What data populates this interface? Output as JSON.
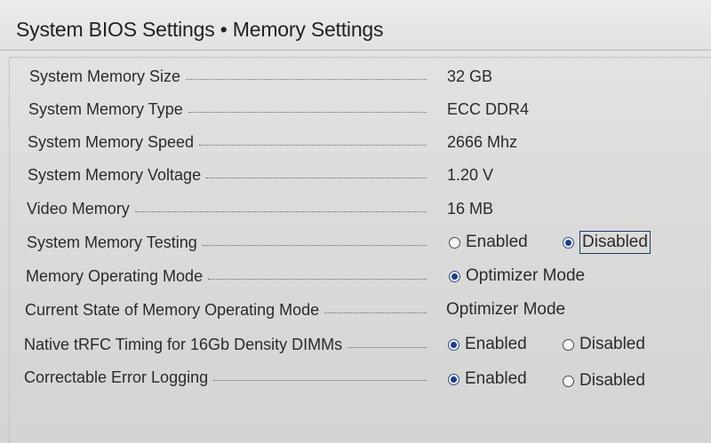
{
  "header": {
    "title": "System BIOS Settings • Memory Settings"
  },
  "rows": [
    {
      "label": "System Memory Size",
      "value": "32 GB"
    },
    {
      "label": "System Memory Type",
      "value": "ECC DDR4"
    },
    {
      "label": "System Memory Speed",
      "value": "2666 Mhz"
    },
    {
      "label": "System Memory Voltage",
      "value": "1.20 V"
    },
    {
      "label": "Video Memory",
      "value": "16 MB"
    },
    {
      "label": "System Memory Testing",
      "options": [
        "Enabled",
        "Disabled"
      ],
      "selected": "Disabled"
    },
    {
      "label": "Memory Operating Mode",
      "options": [
        "Optimizer Mode"
      ],
      "selected": "Optimizer Mode"
    },
    {
      "label": "Current State of Memory Operating Mode",
      "value": "Optimizer Mode"
    },
    {
      "label": "Native tRFC Timing for 16Gb Density DIMMs",
      "options": [
        "Enabled",
        "Disabled"
      ],
      "selected": "Enabled"
    },
    {
      "label": "Correctable Error Logging",
      "options": [
        "Enabled",
        "Disabled"
      ],
      "selected": "Enabled"
    }
  ],
  "colors": {
    "background": "#d9d9d7",
    "radio_selected": "#1c3f8a",
    "focus_border": "#1f3a78"
  }
}
